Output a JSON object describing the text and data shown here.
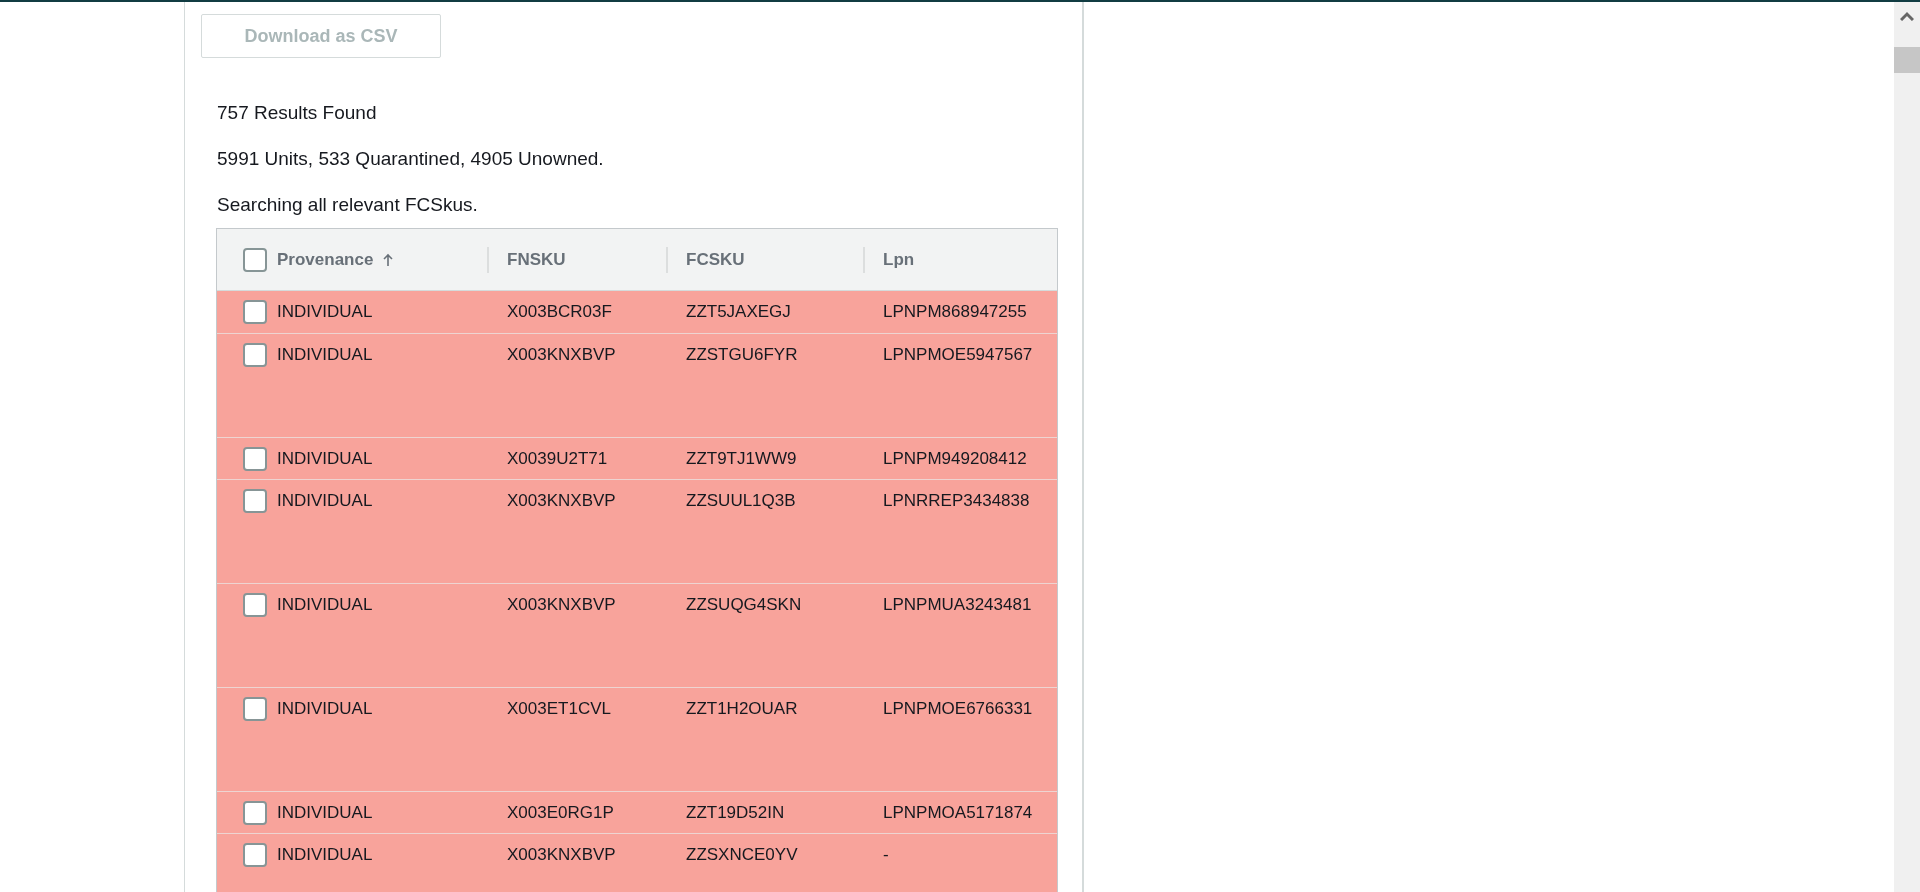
{
  "download_button": {
    "label": "Download as CSV",
    "disabled": true
  },
  "summary": [
    "757 Results Found",
    "5991 Units, 533 Quarantined, 4905 Unowned.",
    "Searching all relevant FCSkus."
  ],
  "table": {
    "select_all": {
      "checked": false
    },
    "columns": [
      {
        "label": "Provenance",
        "sorted": true
      },
      {
        "label": "FNSKU",
        "sorted": false
      },
      {
        "label": "FCSKU",
        "sorted": false
      },
      {
        "label": "Lpn",
        "sorted": false
      }
    ],
    "rows": [
      {
        "kind": "compact",
        "checked": false,
        "cells": [
          "INDIVIDUAL",
          "X003BCR03F",
          "ZZT5JAXEGJ",
          "LPNPM868947255"
        ]
      },
      {
        "kind": "tall",
        "checked": false,
        "cells": [
          "INDIVIDUAL",
          "X003KNXBVP",
          "ZZSTGU6FYR",
          "LPNPMOE5947567"
        ]
      },
      {
        "kind": "compact",
        "checked": false,
        "cells": [
          "INDIVIDUAL",
          "X0039U2T71",
          "ZZT9TJ1WW9",
          "LPNPM949208412"
        ]
      },
      {
        "kind": "tall",
        "checked": false,
        "cells": [
          "INDIVIDUAL",
          "X003KNXBVP",
          "ZZSUUL1Q3B",
          "LPNRREP3434838"
        ]
      },
      {
        "kind": "tall",
        "checked": false,
        "cells": [
          "INDIVIDUAL",
          "X003KNXBVP",
          "ZZSUQG4SKN",
          "LPNPMUA3243481"
        ]
      },
      {
        "kind": "tall",
        "checked": false,
        "cells": [
          "INDIVIDUAL",
          "X003ET1CVL",
          "ZZT1H2OUAR",
          "LPNPMOE6766331"
        ]
      },
      {
        "kind": "compact",
        "checked": false,
        "cells": [
          "INDIVIDUAL",
          "X003E0RG1P",
          "ZZT19D52IN",
          "LPNPMOA5171874"
        ]
      },
      {
        "kind": "tall",
        "checked": false,
        "cells": [
          "INDIVIDUAL",
          "X003KNXBVP",
          "ZZSXNCE0YV",
          "-"
        ]
      }
    ]
  }
}
